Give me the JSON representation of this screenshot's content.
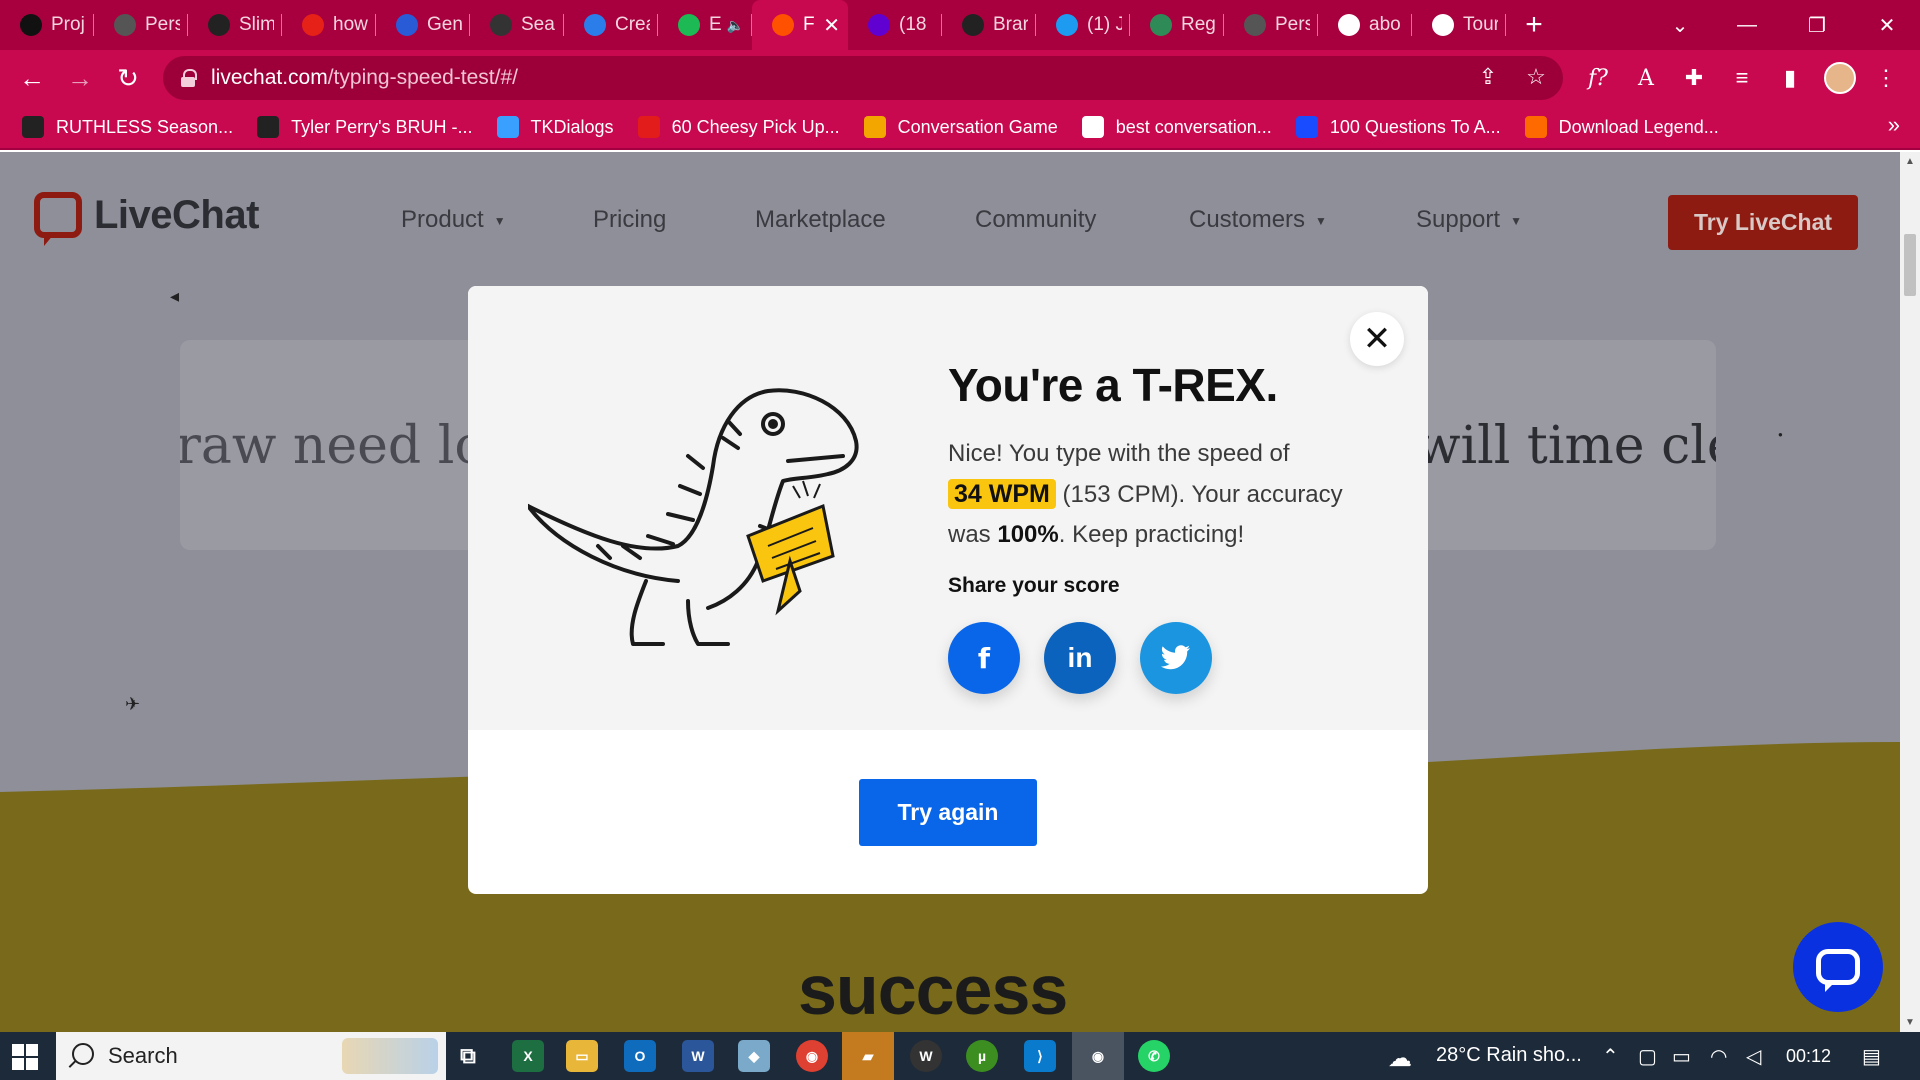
{
  "browser": {
    "tabs": [
      {
        "label": "Proj",
        "icon": "triangle-logo-icon",
        "color": "#111111"
      },
      {
        "label": "Pers",
        "icon": "globe-icon",
        "color": "#555555"
      },
      {
        "label": "Slim",
        "icon": "github-icon",
        "color": "#222222"
      },
      {
        "label": "how",
        "icon": "youtube-icon",
        "color": "#e62117"
      },
      {
        "label": "Geni",
        "icon": "genius-icon",
        "color": "#2a5bd7"
      },
      {
        "label": "Sear",
        "icon": "search-engine-icon",
        "color": "#333333"
      },
      {
        "label": "Crea",
        "icon": "layers-icon",
        "color": "#2b7de9"
      },
      {
        "label": "E",
        "icon": "spotify-icon",
        "color": "#1db954"
      },
      {
        "label": "F",
        "icon": "livechat-icon",
        "color": "#ff5100"
      },
      {
        "label": "(18",
        "icon": "mail-icon",
        "color": "#6001d2"
      },
      {
        "label": "Brar",
        "icon": "github-icon",
        "color": "#222222"
      },
      {
        "label": "(1) J",
        "icon": "twitter-icon",
        "color": "#1d9bf0"
      },
      {
        "label": "Regi",
        "icon": "stack-icon",
        "color": "#2e8b57"
      },
      {
        "label": "Pers",
        "icon": "globe-icon",
        "color": "#555555"
      },
      {
        "label": "abo",
        "icon": "doc-icon",
        "color": "#ffffff"
      },
      {
        "label": "Tour",
        "icon": "doc-icon",
        "color": "#ffffff"
      }
    ],
    "address": {
      "host": "livechat.com",
      "path": "/typing-speed-test/#/"
    },
    "bookmarks": [
      {
        "label": "RUTHLESS Season...",
        "icon": "circle-play-icon",
        "color": "#222222"
      },
      {
        "label": "Tyler Perry's BRUH -...",
        "icon": "circle-play-icon",
        "color": "#222222"
      },
      {
        "label": "TKDialogs",
        "icon": "colorful-logo-icon",
        "color": "#3aa0ff"
      },
      {
        "label": "60 Cheesy Pick Up...",
        "icon": "bl-icon",
        "color": "#e21b1b"
      },
      {
        "label": "Conversation Game",
        "icon": "game-icon",
        "color": "#f3a500"
      },
      {
        "label": "best conversation...",
        "icon": "google-icon",
        "color": "#ffffff"
      },
      {
        "label": "100 Questions To A...",
        "icon": "flag-icon",
        "color": "#1a4cff"
      },
      {
        "label": "Download Legend...",
        "icon": "x-logo-icon",
        "color": "#ff6a00"
      }
    ]
  },
  "site": {
    "logo": "LiveChat",
    "nav": [
      "Product",
      "Pricing",
      "Marketplace",
      "Community",
      "Customers",
      "Support"
    ],
    "cta": "Try LiveChat",
    "typing_left": "raw need lov",
    "typing_right": "will time clea",
    "bottom_heading": "success"
  },
  "modal": {
    "title": "You're a T-REX.",
    "line1": "Nice! You type with the speed of",
    "wpm": "34 WPM",
    "cpm_text": "(153 CPM). Your accuracy",
    "was": "was",
    "accuracy": "100%",
    "keep": ". Keep practicing!",
    "share_label": "Share your score",
    "share": [
      {
        "name": "facebook",
        "glyph": "f",
        "color": "#0a66e8"
      },
      {
        "name": "linkedin",
        "glyph": "in",
        "color": "#0b63bd"
      },
      {
        "name": "twitter",
        "glyph": "t",
        "color": "#1b95e0"
      }
    ],
    "button": "Try again"
  },
  "taskbar": {
    "search_placeholder": "Search",
    "weather": "28°C  Rain sho...",
    "time": "00:12"
  },
  "colors": {
    "chrome": "#c8084f",
    "accent": "#0a66e8",
    "highlight": "#f9c50f"
  }
}
